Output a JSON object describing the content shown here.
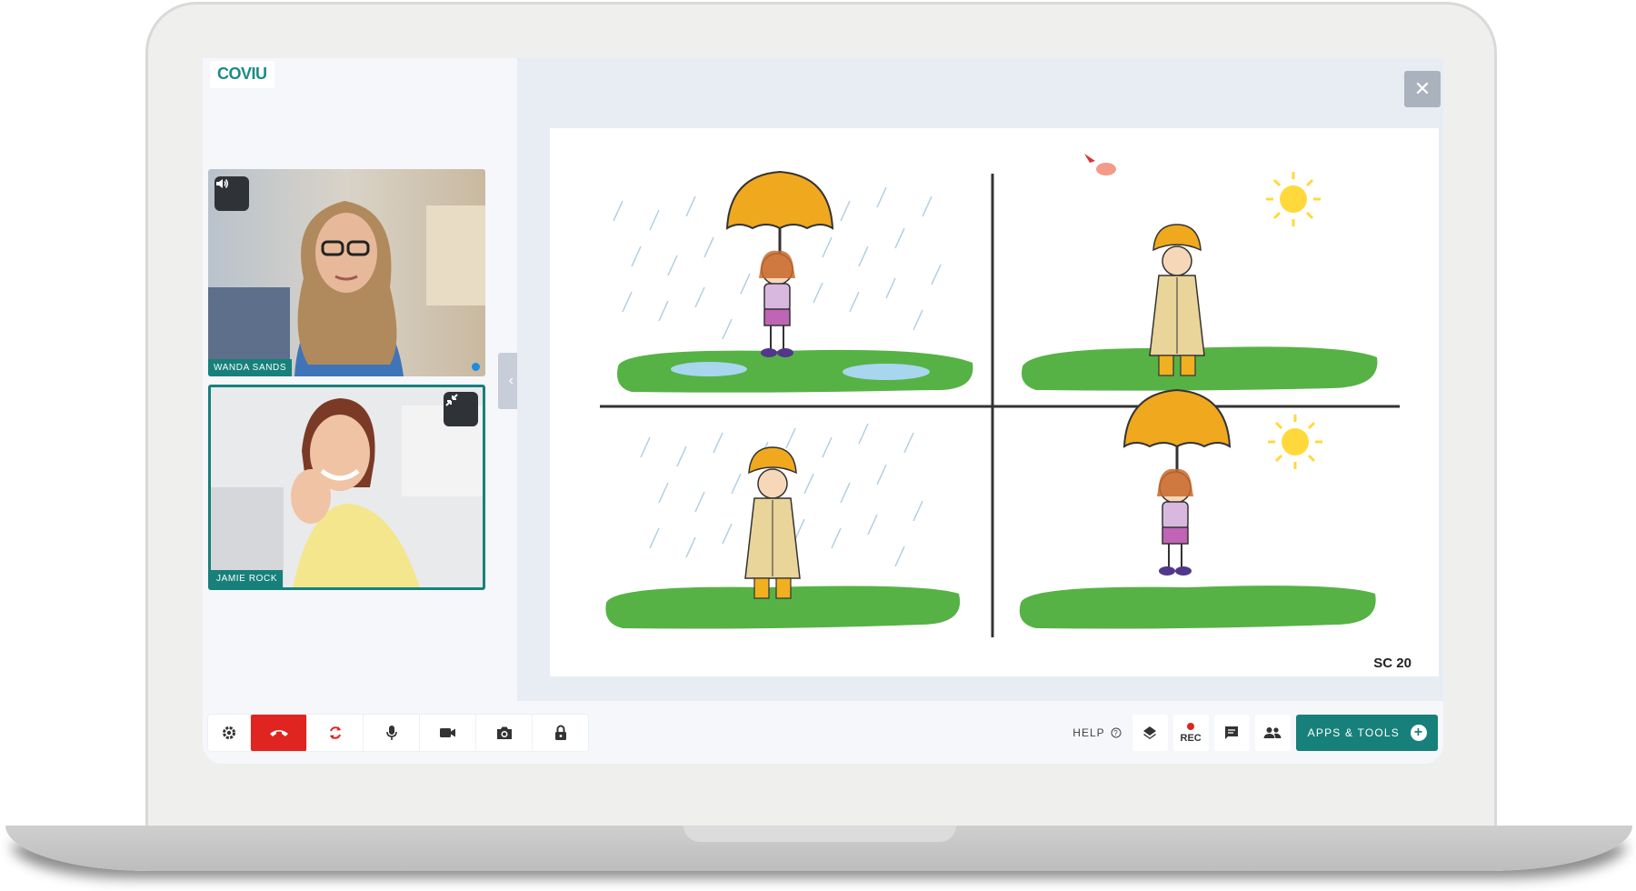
{
  "app": {
    "logo_text": "COVIU"
  },
  "participants": [
    {
      "name": "WANDA SANDS"
    },
    {
      "name": "JAMIE ROCK"
    }
  ],
  "worksheet": {
    "label": "SC 20"
  },
  "toolbar": {
    "help_label": "HELP",
    "rec_label": "REC",
    "apps_label": "APPS & TOOLS",
    "apps_plus": "+"
  },
  "colors": {
    "accent": "#17807a",
    "end_call": "#e0241f",
    "stage_bg": "#e8edf3"
  },
  "icons": {
    "settings": "gear-icon",
    "end_call": "phone-hangup-icon",
    "switch": "refresh-icon",
    "mic": "microphone-icon",
    "camera": "video-camera-icon",
    "snapshot": "camera-icon",
    "lock": "lock-icon",
    "layers": "layers-icon",
    "chat": "chat-icon",
    "people": "people-icon"
  }
}
